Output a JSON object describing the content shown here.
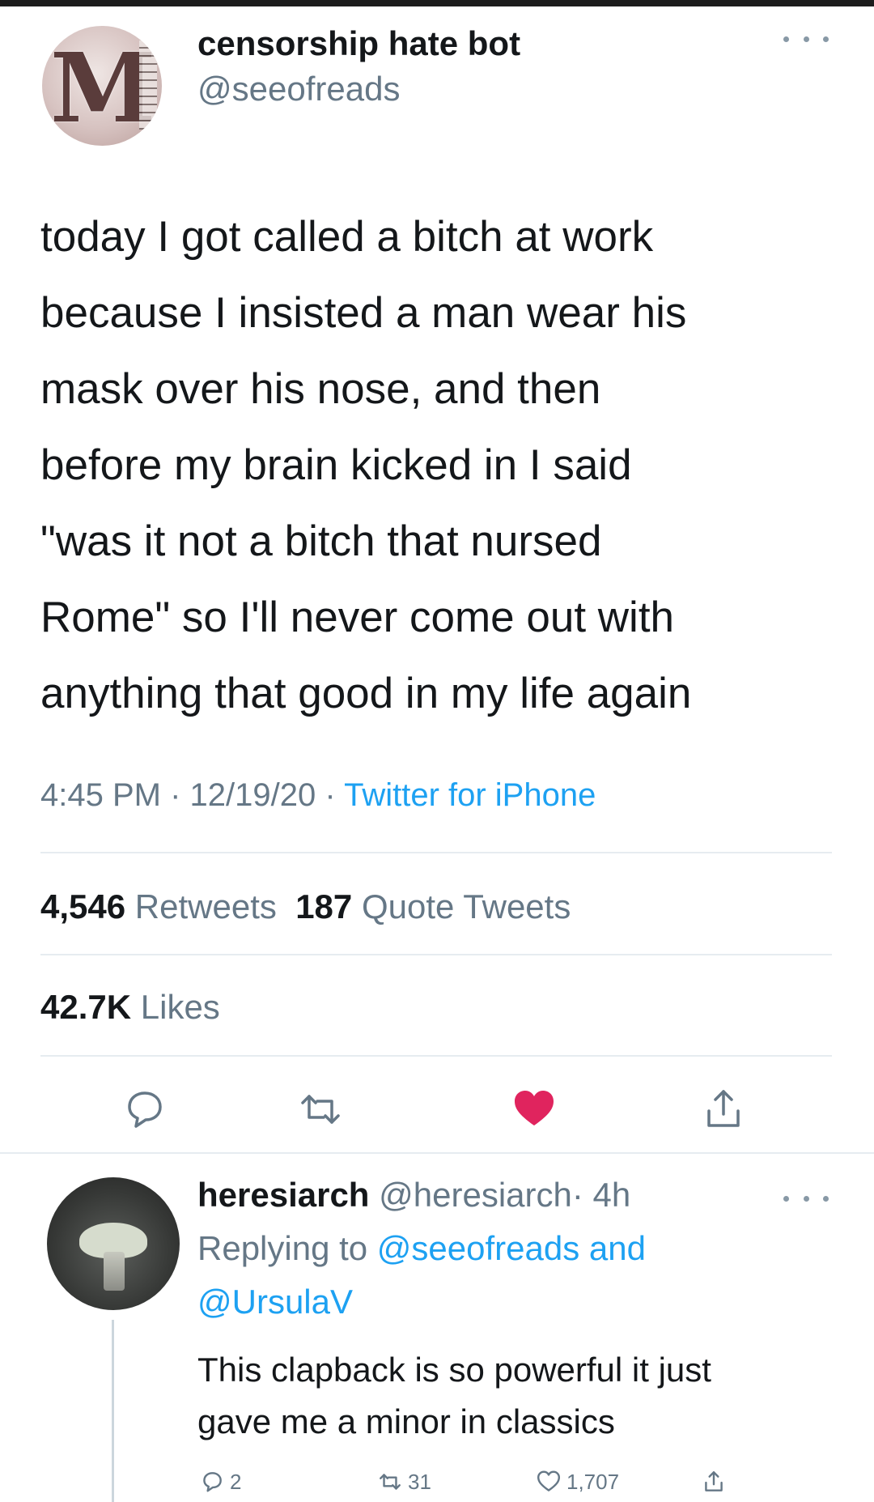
{
  "main_tweet": {
    "display_name": "censorship hate bot",
    "handle": "@seeofreads",
    "avatar_icon": "illuminated-letter-m-icon",
    "text_lines": [
      "today I got called a bitch at work",
      "because I insisted a man wear his",
      "mask over his nose, and then",
      "before my brain kicked in I said",
      "\"was it not a bitch that nursed",
      "Rome\" so I'll never come out with",
      "anything that good in my life again"
    ],
    "time": "4:45 PM",
    "date": "12/19/20",
    "separator": "·",
    "source": "Twitter for iPhone",
    "retweets_count": "4,546",
    "retweets_label": "Retweets",
    "quotes_count": "187",
    "quotes_label": "Quote Tweets",
    "likes_count": "42.7K",
    "likes_label": "Likes",
    "liked": true,
    "like_color": "#e0245e",
    "link_color": "#1da1f2"
  },
  "reply": {
    "display_name": "heresiarch",
    "handle": "@heresiarch",
    "age": "· 4h",
    "replying_prefix": "Replying to",
    "replying_to_1": "@seeofreads",
    "replying_and": "and",
    "replying_to_2": "@UrsulaV",
    "text_lines": [
      "This clapback is so powerful it just",
      "gave me a minor in classics"
    ],
    "reply_count": "2",
    "retweet_count": "31",
    "like_count": "1,707"
  }
}
